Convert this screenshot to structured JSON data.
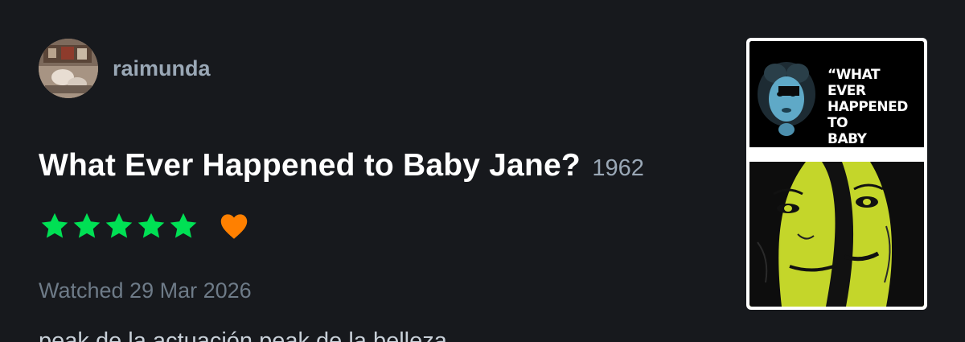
{
  "reviewer": {
    "username": "raimunda",
    "avatar_icon": "user-avatar"
  },
  "film": {
    "title": "What Ever Happened to Baby Jane?",
    "year": "1962"
  },
  "rating": {
    "stars": 5,
    "max_stars": 5,
    "liked": true,
    "star_color": "#00e054",
    "like_color": "#ff8000"
  },
  "watched_label": "Watched 29 Mar 2026",
  "review_text": "peak de la actuación peak de la belleza",
  "poster": {
    "title_lines": [
      "“WHAT EVER",
      "HAPPENED TO",
      "BABY JANE?”"
    ]
  },
  "colors": {
    "background": "#17191d",
    "username": "#9aa8b6",
    "muted": "#6e7b88"
  }
}
